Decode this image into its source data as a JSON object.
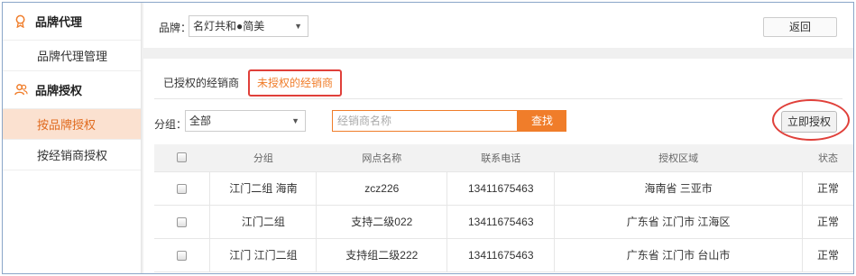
{
  "sidebar": {
    "group1": {
      "label": "品牌代理",
      "icon": "badge-icon"
    },
    "item1": "品牌代理管理",
    "group2": {
      "label": "品牌授权",
      "icon": "users-icon"
    },
    "item2": "按品牌授权",
    "item3": "按经销商授权"
  },
  "header": {
    "brand_label": "品牌：",
    "brand_value": "名灯共和●简美",
    "back_label": "返回"
  },
  "tabs": {
    "authorized": "已授权的经销商",
    "unauthorized": "未授权的经销商"
  },
  "filters": {
    "group_label": "分组：",
    "group_value": "全部",
    "search_placeholder": "经销商名称",
    "search_btn": "查找",
    "authorize_btn": "立即授权"
  },
  "table": {
    "headers": [
      "分组",
      "网点名称",
      "联系电话",
      "授权区域",
      "状态"
    ],
    "rows": [
      {
        "group": "江门二组 海南",
        "name": "zcz226",
        "phone": "13411675463",
        "area": "海南省 三亚市",
        "status": "正常"
      },
      {
        "group": "江门二组",
        "name": "支持二级022",
        "phone": "13411675463",
        "area": "广东省 江门市 江海区",
        "status": "正常"
      },
      {
        "group": "江门 江门二组",
        "name": "支持组二级222",
        "phone": "13411675463",
        "area": "广东省 江门市 台山市",
        "status": "正常"
      }
    ]
  },
  "colors": {
    "accent": "#f07d2a",
    "highlight_ring": "#e0403a",
    "active_bg": "#fbe1d0"
  }
}
